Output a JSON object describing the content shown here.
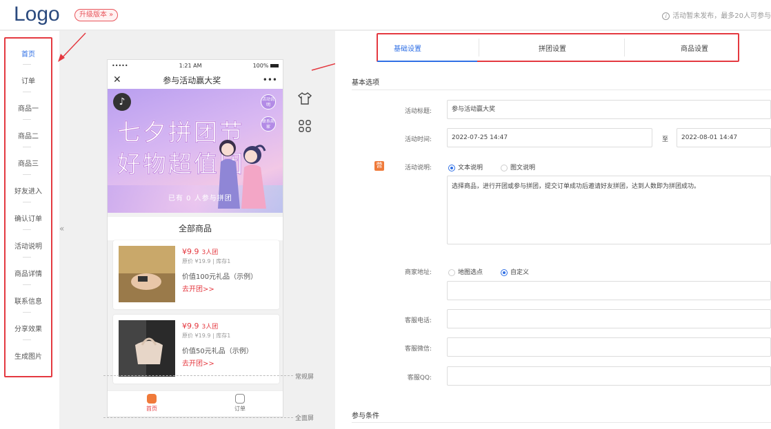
{
  "header": {
    "logo": "Logo",
    "upgrade": "升级版本 »",
    "notice": "活动暂未发布，最多20人可参与"
  },
  "leftnav": {
    "items": [
      "首页",
      "订单",
      "商品一",
      "商品二",
      "商品三",
      "好友进入",
      "确认订单",
      "活动说明",
      "商品详情",
      "联系信息",
      "分享效果",
      "生成图片"
    ],
    "collapse": "«"
  },
  "phone": {
    "status_left": "•••••",
    "time": "1:21 AM",
    "battery": "100%",
    "close": "✕",
    "title": "参与活动赢大奖",
    "more": "•••",
    "banner_line1": "七夕拼团节",
    "banner_line2": "好物超值团",
    "bubble1": "活动说明",
    "bubble2": "联系商家",
    "joined": "已有 0 人参与拼团",
    "section_title": "全部商品",
    "products": [
      {
        "price": "¥9.9",
        "group": "3人团",
        "orig": "原价 ¥19.9 | 库存1",
        "gift": "价值100元礼品（示例）",
        "go": "去开团>>"
      },
      {
        "price": "¥9.9",
        "group": "3人团",
        "orig": "原价 ¥19.9 | 库存1",
        "gift": "价值50元礼品（示例）",
        "go": "去开团>>"
      }
    ],
    "tab_home": "首页",
    "tab_order": "订单"
  },
  "side_labels": {
    "normal": "常规屏",
    "full": "全面屏"
  },
  "tabs": [
    "基础设置",
    "拼团设置",
    "商品设置"
  ],
  "form": {
    "group_basic": "基本选项",
    "title_label": "活动标题:",
    "title_value": "参与活动赢大奖",
    "time_label": "活动时间:",
    "time_start": "2022-07-25 14:47",
    "time_to": "至",
    "time_end": "2022-08-01 14:47",
    "desc_badge": "营",
    "desc_label": "活动说明:",
    "desc_opt1": "文本说明",
    "desc_opt2": "图文说明",
    "desc_text": "选择商品，进行开团或参与拼团，提交订单成功后邀请好友拼团，达到人数即为拼团成功。",
    "addr_label": "商家地址:",
    "addr_opt1": "地图选点",
    "addr_opt2": "自定义",
    "phone_label": "客服电话:",
    "wechat_label": "客服微信:",
    "qq_label": "客服QQ:",
    "group_cond": "参与条件"
  }
}
